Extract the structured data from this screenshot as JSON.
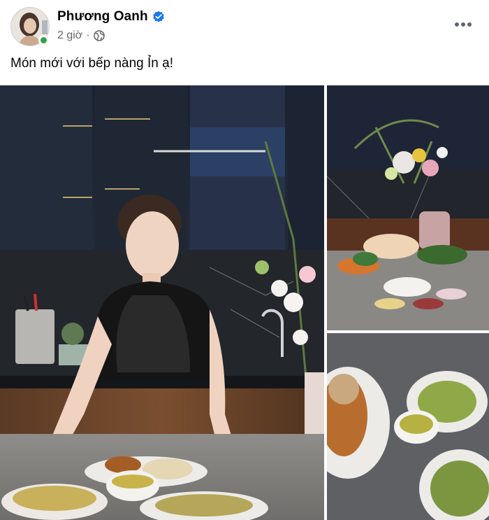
{
  "post": {
    "author": "Phương Oanh",
    "verified": true,
    "time": "2 giờ",
    "separator": "·",
    "privacy_icon": "globe-icon",
    "more_icon": "more-horizontal-icon",
    "caption": "Món mới với bếp nàng Ỉn ạ!"
  },
  "photos": [
    {
      "name": "photo-woman-serving-dishes",
      "alt": "Woman in black apron arranging dishes on kitchen counter"
    },
    {
      "name": "photo-ingredients-table",
      "alt": "Ingredients and flower vase on kitchen table"
    },
    {
      "name": "photo-finished-dishes",
      "alt": "Plates of finished dishes on counter"
    }
  ],
  "colors": {
    "verified_blue": "#1877f2",
    "online_green": "#31a24c",
    "secondary_text": "#65676b"
  }
}
